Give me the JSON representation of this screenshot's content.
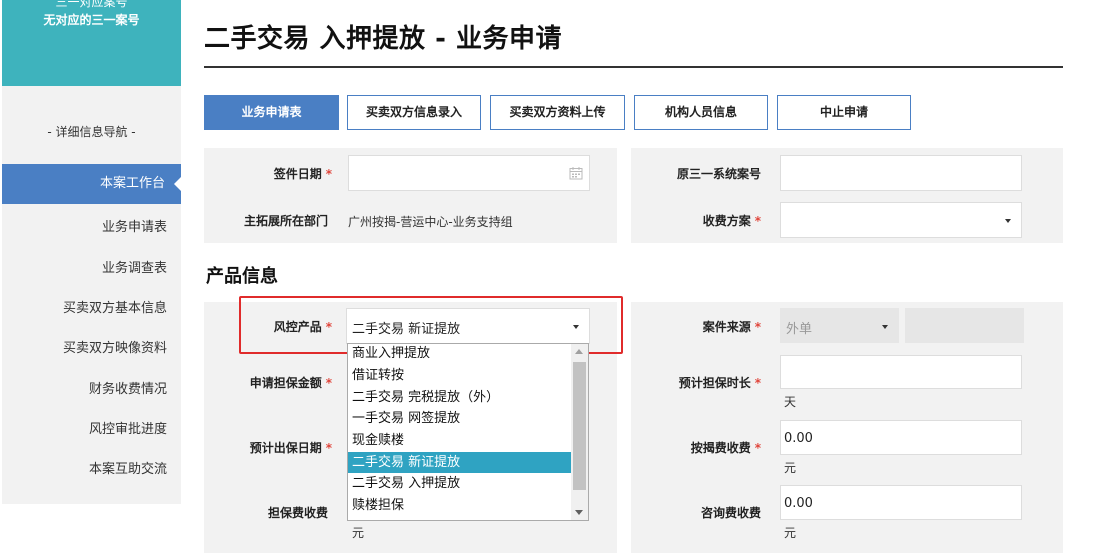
{
  "sidebar": {
    "case_line1": "三一对应案号",
    "case_line2": "无对应的三一案号",
    "nav_title": "- 详细信息导航 -",
    "items": [
      {
        "label": "本案工作台",
        "active": true
      },
      {
        "label": "业务申请表"
      },
      {
        "label": "业务调查表"
      },
      {
        "label": "买卖双方基本信息"
      },
      {
        "label": "买卖双方映像资料"
      },
      {
        "label": "财务收费情况"
      },
      {
        "label": "风控审批进度"
      },
      {
        "label": "本案互助交流"
      }
    ]
  },
  "page": {
    "title": "二手交易 入押提放 - 业务申请"
  },
  "tabs": [
    {
      "label": "业务申请表",
      "active": true
    },
    {
      "label": "买卖双方信息录入"
    },
    {
      "label": "买卖双方资料上传"
    },
    {
      "label": "机构人员信息"
    },
    {
      "label": "中止申请"
    }
  ],
  "form": {
    "sign_date_label": "签件日期",
    "orig_case_label": "原三一系统案号",
    "dept_label": "主拓展所在部门",
    "dept_value": "广州按揭-营运中心-业务支持组",
    "fee_plan_label": "收费方案",
    "required_mark": "*"
  },
  "product": {
    "section_title": "产品信息",
    "risk_product_label": "风控产品",
    "risk_product_value": "二手交易 新证提放",
    "case_source_label": "案件来源",
    "case_source_value": "外单",
    "guarantee_amount_label": "申请担保金额",
    "guarantee_duration_label": "预计担保时长",
    "duration_unit": "天",
    "guarantee_date_label": "预计出保日期",
    "mortgage_fee_label": "按揭费收费",
    "mortgage_fee_value": "0.00",
    "mortgage_fee_unit": "元",
    "guarantee_fee_label": "担保费收费",
    "guarantee_fee_unit": "元",
    "consult_fee_label": "咨询费收费",
    "consult_fee_value": "0.00",
    "consult_fee_unit": "元"
  },
  "dropdown": {
    "options": [
      "商业入押提放",
      "借证转按",
      "二手交易 完税提放（外）",
      "一手交易 网签提放",
      "现金赎楼",
      "二手交易 新证提放",
      "二手交易 入押提放",
      "赎楼担保"
    ],
    "selected_index": 5
  },
  "colors": {
    "accent": "#4a7fc4",
    "sidebar_header": "#3eb3bd",
    "selected_option": "#2fa3c2",
    "highlight_box": "#e02b2b",
    "required": "#e0453b"
  }
}
